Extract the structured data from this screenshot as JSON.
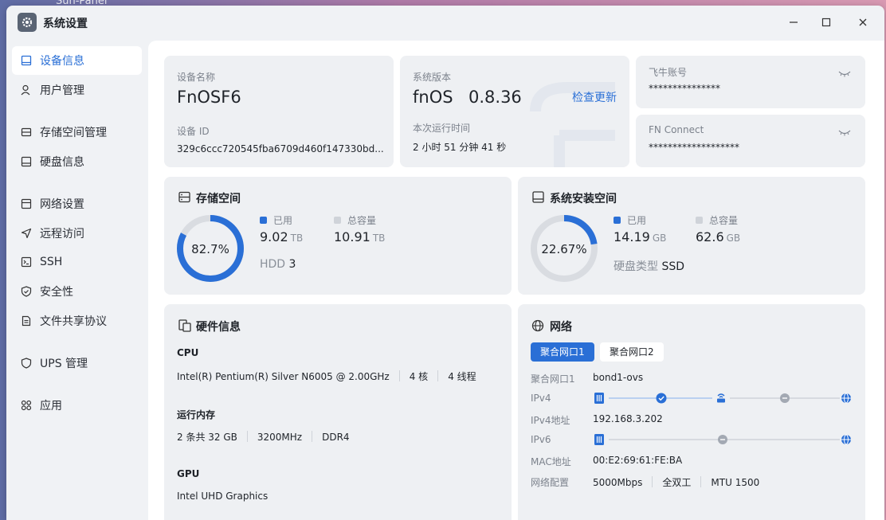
{
  "background_app": "Sun-Panel",
  "window": {
    "title": "系统设置"
  },
  "sidebar": {
    "items": [
      {
        "label": "设备信息"
      },
      {
        "label": "用户管理"
      },
      {
        "label": "存储空间管理"
      },
      {
        "label": "硬盘信息"
      },
      {
        "label": "网络设置"
      },
      {
        "label": "远程访问"
      },
      {
        "label": "SSH"
      },
      {
        "label": "安全性"
      },
      {
        "label": "文件共享协议"
      },
      {
        "label": "UPS 管理"
      },
      {
        "label": "应用"
      }
    ]
  },
  "device": {
    "name_label": "设备名称",
    "name": "FnOSF6",
    "id_label": "设备 ID",
    "id": "329c6ccc720545fba6709d460f147330bd..."
  },
  "system": {
    "version_label": "系统版本",
    "os": "fnOS",
    "version": "0.8.36",
    "check_update": "检查更新",
    "uptime_label": "本次运行时间",
    "uptime": "2 小时 51 分钟 41 秒"
  },
  "accounts": {
    "feiniu_label": "飞牛账号",
    "feiniu_value": "***************",
    "fnconnect_label": "FN Connect",
    "fnconnect_value": "*******************"
  },
  "storage": {
    "title": "存储空间",
    "percent_text": "82.7%",
    "percent": 82.7,
    "used_label": "已用",
    "used": "9.02",
    "used_unit": "TB",
    "total_label": "总容量",
    "total": "10.91",
    "total_unit": "TB",
    "disk_label": "HDD",
    "disk_count": "3"
  },
  "sys_space": {
    "title": "系统安装空间",
    "percent_text": "22.67%",
    "percent": 22.67,
    "used_label": "已用",
    "used": "14.19",
    "used_unit": "GB",
    "total_label": "总容量",
    "total": "62.6",
    "total_unit": "GB",
    "disk_type_label": "硬盘类型",
    "disk_type": "SSD"
  },
  "hardware": {
    "title": "硬件信息",
    "cpu_label": "CPU",
    "cpu_model": "Intel(R) Pentium(R) Silver N6005 @ 2.00GHz",
    "cpu_cores": "4 核",
    "cpu_threads": "4 线程",
    "ram_label": "运行内存",
    "ram_size": "2 条共 32 GB",
    "ram_speed": "3200MHz",
    "ram_type": "DDR4",
    "gpu_label": "GPU",
    "gpu_model": "Intel UHD Graphics"
  },
  "network": {
    "title": "网络",
    "tabs": [
      {
        "label": "聚合网口1"
      },
      {
        "label": "聚合网口2"
      }
    ],
    "iface_label": "聚合网口1",
    "iface": "bond1-ovs",
    "ipv4_label": "IPv4",
    "ipv4_addr_label": "IPv4地址",
    "ipv4_addr": "192.168.3.202",
    "ipv6_label": "IPv6",
    "mac_label": "MAC地址",
    "mac": "00:E2:69:61:FE:BA",
    "config_label": "网络配置",
    "speed": "5000Mbps",
    "duplex": "全双工",
    "mtu": "MTU 1500"
  },
  "colors": {
    "accent": "#2a6fd6",
    "ring_track": "#d9dce1",
    "card_bg": "#eef0f3",
    "used_square": "#2a6fd6",
    "total_square": "#cfd3d9"
  }
}
